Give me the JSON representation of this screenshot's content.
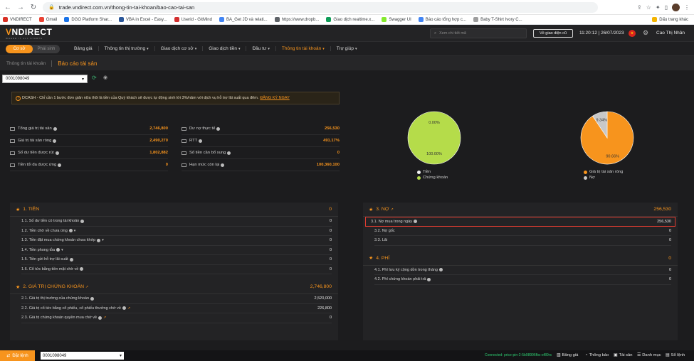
{
  "browser": {
    "url": "trade.vndirect.com.vn/thong-tin-tai-khoan/bao-cao-tai-san",
    "bookmarks": [
      {
        "label": "VNDIRECT",
        "color": "#d93025"
      },
      {
        "label": "Gmail",
        "color": "#ea4335"
      },
      {
        "label": "DGO Platform Shar...",
        "color": "#1a73e8"
      },
      {
        "label": "VBA in Excel - Easy...",
        "color": "#2b579a"
      },
      {
        "label": "Userid - GitMind",
        "color": "#d32f2f"
      },
      {
        "label": "BA_Get JD và relati...",
        "color": "#4285f4"
      },
      {
        "label": "https://www.dropb...",
        "color": "#5f6368"
      },
      {
        "label": "Giao dịch realtime.x...",
        "color": "#0f9d58"
      },
      {
        "label": "Swagger UI",
        "color": "#85ea2d"
      },
      {
        "label": "Báo cáo tổng hợp c...",
        "color": "#4285f4"
      },
      {
        "label": "Baby T-Shirt Ivory C...",
        "color": "#9e9e9e"
      }
    ],
    "bookmark_folder": "Dấu trang khác"
  },
  "header": {
    "logo_main": "VNDIRECT",
    "logo_tag": "WHERE IT ALL STARTS",
    "search_placeholder": "Xem chi tiết mã",
    "old_ui_label": "Về giao diện cũ",
    "datetime": "11:20:12 | 26/07/2023",
    "user_name": "Cao Thị Nhân"
  },
  "menu": {
    "mode_basic": "Cơ sở",
    "mode_derivative": "Phái sinh",
    "items": [
      {
        "label": "Bảng giá",
        "caret": false,
        "active": false
      },
      {
        "label": "Thông tin thị trường",
        "caret": true,
        "active": false
      },
      {
        "label": "Giao dịch cơ sở",
        "caret": true,
        "active": false
      },
      {
        "label": "Giao dịch tiền",
        "caret": true,
        "active": false
      },
      {
        "label": "Đầu tư",
        "caret": true,
        "active": false
      },
      {
        "label": "Thông tin tài khoản",
        "caret": true,
        "active": true
      },
      {
        "label": "Trợ giúp",
        "caret": true,
        "active": false
      }
    ]
  },
  "breadcrumb": {
    "parent": "Thông tin tài khoản",
    "current": "Báo cáo tài sản"
  },
  "account": "0001098049",
  "notice": {
    "text": "DCASH - Chỉ cần 1 bước đơn giản nữa thôi là tiền của Quý khách sẽ được tự động sinh lời 3%/năm với dịch vụ hỗ trợ lãi suất qua đêm.",
    "link": "ĐĂNG KÝ NGAY"
  },
  "stats_left": [
    {
      "label": "Tổng giá trị tài sản",
      "value": "2,746,800"
    },
    {
      "label": "Giá trị tài sản ròng",
      "value": "2,490,270"
    },
    {
      "label": "Số dư tiền được rút",
      "value": "1,802,882"
    },
    {
      "label": "Tiền tối đa được ứng",
      "value": "0"
    }
  ],
  "stats_right": [
    {
      "label": "Dư nợ thực tế",
      "value": "256,530"
    },
    {
      "label": "RTT",
      "value": "491.17%"
    },
    {
      "label": "Số tiền cần bổ sung",
      "value": "0"
    },
    {
      "label": "Hạn mức còn lại",
      "value": "100,360,100"
    }
  ],
  "chart_data": [
    {
      "type": "pie",
      "categories": [
        "Tiền",
        "Chứng khoán"
      ],
      "values": [
        0.0,
        100.0
      ],
      "data_labels": [
        "0.00%",
        "100.00%"
      ],
      "colors": [
        "#f2f2f2",
        "#b5dc4a"
      ],
      "legend": "bottom-left"
    },
    {
      "type": "pie",
      "categories": [
        "Giá trị tài sản ròng",
        "Nợ"
      ],
      "values": [
        90.66,
        9.34
      ],
      "data_labels": [
        "90.66%",
        "9.34%"
      ],
      "colors": [
        "#f7941d",
        "#c8c8c8"
      ],
      "legend": "bottom-left"
    }
  ],
  "sections_left": [
    {
      "title": "1. TIỀN",
      "value": "0",
      "ext": false,
      "rows": [
        {
          "label": "1.1. Số dư tiền có trong tài khoản",
          "value": "0",
          "info": true,
          "caret": false,
          "ext": false
        },
        {
          "label": "1.2. Tiền chờ về chưa ứng",
          "value": "0",
          "info": true,
          "caret": true,
          "ext": false
        },
        {
          "label": "1.3. Tiền đặt mua chứng khoán chưa khớp",
          "value": "0",
          "info": true,
          "caret": true,
          "ext": false
        },
        {
          "label": "1.4. Tiền phong tỏa",
          "value": "0",
          "info": true,
          "caret": true,
          "ext": false
        },
        {
          "label": "1.5. Tiền gửi hỗ trợ lãi suất",
          "value": "0",
          "info": true,
          "caret": false,
          "ext": false
        },
        {
          "label": "1.6. Cổ tức bằng tiền mặt chờ về",
          "value": "0",
          "info": true,
          "caret": false,
          "ext": false
        }
      ]
    },
    {
      "title": "2. GIÁ TRỊ CHỨNG KHOÁN",
      "value": "2,746,800",
      "ext": true,
      "rows": [
        {
          "label": "2.1. Giá trị thị trường của chứng khoán",
          "value": "2,520,000",
          "info": true,
          "caret": false,
          "ext": false
        },
        {
          "label": "2.2. Giá trị cổ tức bằng cổ phiếu, cổ phiếu thưởng chờ về",
          "value": "226,800",
          "info": true,
          "caret": false,
          "ext": true
        },
        {
          "label": "2.3. Giá trị chứng khoán quyền mua chờ về",
          "value": "0",
          "info": true,
          "caret": false,
          "ext": true
        }
      ]
    }
  ],
  "sections_right": [
    {
      "title": "3. NỢ",
      "value": "256,530",
      "ext": true,
      "rows": [
        {
          "label": "3.1. Nợ mua trong ngày",
          "value": "256,530",
          "info": true,
          "caret": false,
          "ext": false,
          "highlight": true
        },
        {
          "label": "3.2. Nợ gốc",
          "value": "0",
          "info": false,
          "caret": false,
          "ext": false
        },
        {
          "label": "3.3. Lãi",
          "value": "0",
          "info": false,
          "caret": false,
          "ext": false
        }
      ]
    },
    {
      "title": "4. PHÍ",
      "value": "0",
      "ext": false,
      "rows": [
        {
          "label": "4.1. Phí lưu ký cộng dồn trong tháng",
          "value": "0",
          "info": true,
          "caret": false,
          "ext": false
        },
        {
          "label": "4.2. Phí chứng khoán phải trả",
          "value": "0",
          "info": true,
          "caret": false,
          "ext": false
        }
      ]
    }
  ],
  "footer": {
    "order_label": "Đặt lệnh",
    "account": "0001098049",
    "connection": "Connected: price-pin-2-5b98996fbc-ef89rs",
    "items": [
      {
        "label": "Bảng giá",
        "icon": "chart-icon"
      },
      {
        "label": "Thông báo",
        "icon": "bell-icon"
      },
      {
        "label": "Tài sản",
        "icon": "wallet-icon"
      },
      {
        "label": "Danh mục",
        "icon": "list-icon"
      },
      {
        "label": "Sổ lệnh",
        "icon": "book-icon"
      }
    ]
  }
}
